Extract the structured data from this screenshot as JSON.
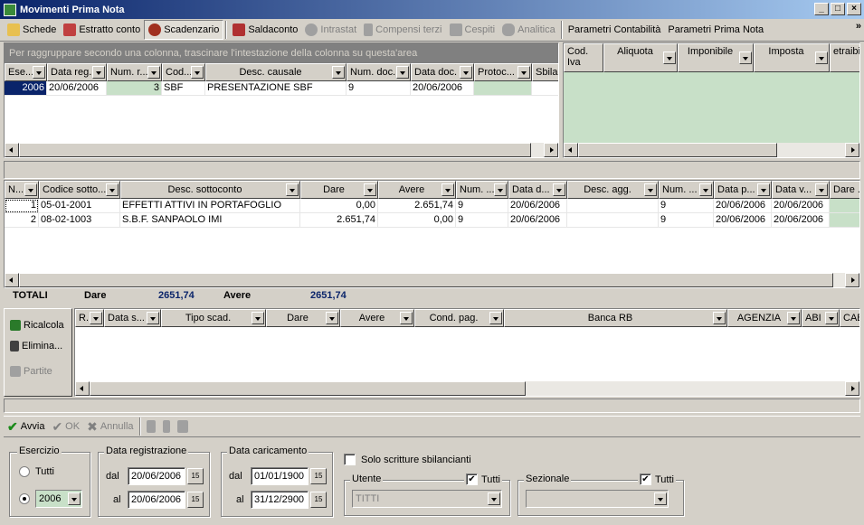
{
  "window": {
    "title": "Movimenti Prima Nota"
  },
  "toolbar": {
    "items": [
      {
        "label": "Schede",
        "icon": "card-icon",
        "enabled": true
      },
      {
        "label": "Estratto conto",
        "icon": "statement-icon",
        "enabled": true
      },
      {
        "label": "Scadenzario",
        "icon": "clock-icon",
        "enabled": true,
        "pressed": true
      },
      {
        "label": "Saldaconto",
        "icon": "car-icon",
        "enabled": true
      },
      {
        "label": "Intrastat",
        "icon": "circle-icon",
        "enabled": false
      },
      {
        "label": "Compensi terzi",
        "icon": "doc-icon",
        "enabled": false
      },
      {
        "label": "Cespiti",
        "icon": "box-icon",
        "enabled": false
      },
      {
        "label": "Analitica",
        "icon": "gears-icon",
        "enabled": false
      },
      {
        "label": "Parametri Contabilità",
        "enabled": true
      },
      {
        "label": "Parametri Prima Nota",
        "enabled": true
      }
    ],
    "overflow": "»"
  },
  "top_grid": {
    "group_hint": "Per raggruppare secondo una colonna, trascinare l'intestazione della colonna su questa'area",
    "columns": [
      "Ese...",
      "Data reg.",
      "Num. r...",
      "Cod...",
      "Desc. causale",
      "Num. doc.",
      "Data doc.",
      "Protoc...",
      "Sbilan"
    ],
    "rows": [
      [
        "2006",
        "20/06/2006",
        "3",
        "SBF",
        "PRESENTAZIONE SBF",
        "9",
        "20/06/2006",
        "",
        ""
      ]
    ]
  },
  "iva_grid": {
    "columns": [
      "Cod. Iva",
      "Aliquota",
      "Imponibile",
      "Imposta",
      "etraibi"
    ]
  },
  "mid_grid": {
    "columns": [
      "N...",
      "Codice sotto...",
      "Desc. sottoconto",
      "Dare",
      "Avere",
      "Num. ...",
      "Data d...",
      "Desc. agg.",
      "Num. ...",
      "Data p...",
      "Data v...",
      "Dare ..."
    ],
    "rows": [
      [
        "1",
        "05-01-2001",
        "EFFETTI ATTIVI IN PORTAFOGLIO",
        "0,00",
        "2.651,74",
        "9",
        "20/06/2006",
        "",
        "9",
        "20/06/2006",
        "20/06/2006",
        ""
      ],
      [
        "2",
        "08-02-1003",
        "S.B.F. SANPAOLO IMI",
        "2.651,74",
        "0,00",
        "9",
        "20/06/2006",
        "",
        "9",
        "20/06/2006",
        "20/06/2006",
        ""
      ]
    ]
  },
  "totals": {
    "label": "TOTALI",
    "dare_label": "Dare",
    "dare_value": "2651,74",
    "avere_label": "Avere",
    "avere_value": "2651,74"
  },
  "scad_buttons": {
    "ricalcola": "Ricalcola",
    "elimina": "Elimina...",
    "partite": "Partite"
  },
  "scad_grid": {
    "columns": [
      "R...",
      "Data s...",
      "Tipo scad.",
      "Dare",
      "Avere",
      "Cond. pag.",
      "Banca RB",
      "AGENZIA",
      "ABI",
      "CAB"
    ]
  },
  "actions": {
    "avvia": "Avvia",
    "ok": "OK",
    "annulla": "Annulla"
  },
  "filters": {
    "esercizio": {
      "legend": "Esercizio",
      "tutti": "Tutti",
      "value": "2006"
    },
    "data_reg": {
      "legend": "Data registrazione",
      "dal_label": "dal",
      "dal": "20/06/2006",
      "al_label": "al",
      "al": "20/06/2006"
    },
    "data_car": {
      "legend": "Data caricamento",
      "dal_label": "dal",
      "dal": "01/01/1900",
      "al_label": "al",
      "al": "31/12/2900"
    },
    "solo": "Solo scritture sbilancianti",
    "utente": {
      "legend": "Utente",
      "tutti": "Tutti",
      "value": "TITTI"
    },
    "sezionale": {
      "legend": "Sezionale",
      "tutti": "Tutti",
      "value": ""
    },
    "cal_icon": "15"
  }
}
